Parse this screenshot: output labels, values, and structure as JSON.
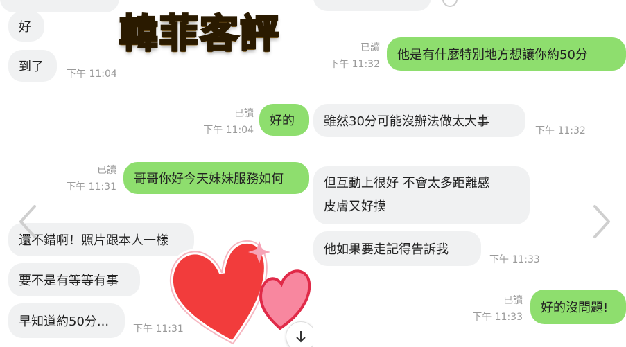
{
  "logo": {
    "text": "韓菲客評"
  },
  "left_chat": {
    "received": [
      {
        "text": "好"
      },
      {
        "text": "到了",
        "time": "下午 11:04"
      },
      {
        "text": "還不錯啊！照片跟本人一樣"
      },
      {
        "text": "要不是有等等有事"
      },
      {
        "text": "早知道約50分...",
        "time": "下午 11:31"
      }
    ],
    "sent": [
      {
        "text": "好的",
        "read": "已讀",
        "time": "下午 11:04"
      },
      {
        "text": "哥哥你好今天妹妹服務如何",
        "read": "已讀",
        "time": "下午 11:31"
      }
    ]
  },
  "right_chat": {
    "sent": [
      {
        "text": "他是有什麼特別地方想讓你約50分",
        "read": "已讀",
        "time": "下午 11:32"
      },
      {
        "text": "好的沒問題!",
        "read": "已讀",
        "time": "下午 11:33"
      }
    ],
    "received": [
      {
        "text": "雖然30分可能沒辦法做太大事",
        "time": "下午 11:32"
      },
      {
        "line1": "但互動上很好 不會太多距離感",
        "line2": "皮膚又好摸"
      },
      {
        "text": "他如果要走記得告訴我",
        "time": "下午 11:33"
      }
    ]
  },
  "colors": {
    "sent_bubble": "#8ede6e",
    "received_bubble": "#f0f1f2",
    "timestamp": "#9a9a9a",
    "logo_gold": "#f6c33a"
  },
  "icons": {
    "scroll_down": "arrow-down-icon",
    "nav_left": "chevron-left-icon",
    "nav_right": "chevron-right-icon",
    "stickers": "heart-sticker-icon"
  }
}
